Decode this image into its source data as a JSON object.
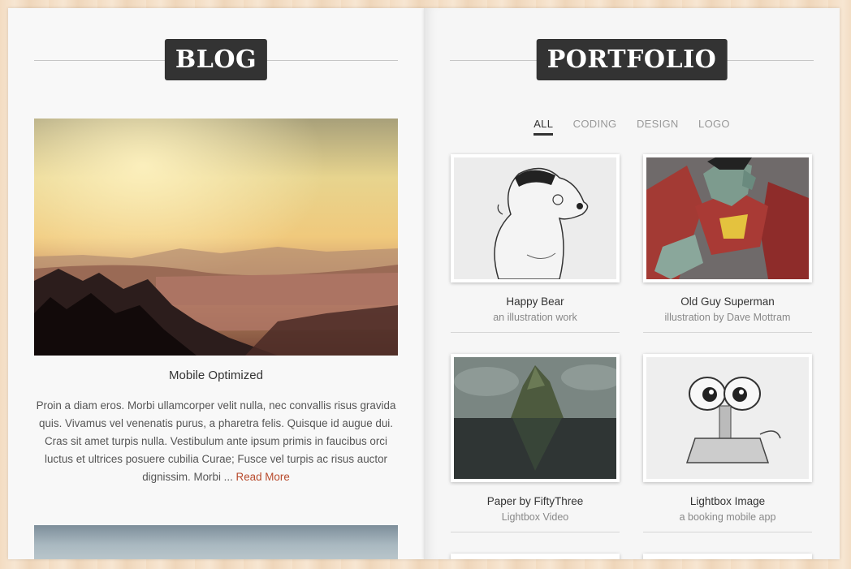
{
  "blog": {
    "heading": "BLOG",
    "post": {
      "title": "Mobile Optimized",
      "excerpt": "Proin a diam eros. Morbi ullamcorper velit nulla, nec convallis risus gravida quis. Vivamus vel venenatis purus, a pharetra felis. Quisque id augue dui. Cras sit amet turpis nulla. Vestibulum ante ipsum primis in faucibus orci luctus et ultrices posuere cubilia Curae; Fusce vel turpis ac risus auctor dignissim. Morbi ... ",
      "read_more": "Read More"
    }
  },
  "portfolio": {
    "heading": "PORTFOLIO",
    "filters": [
      "ALL",
      "CODING",
      "DESIGN",
      "LOGO"
    ],
    "active_filter": "ALL",
    "items": [
      {
        "title": "Happy Bear",
        "subtitle": "an illustration work"
      },
      {
        "title": "Old Guy Superman",
        "subtitle": "illustration by Dave Mottram"
      },
      {
        "title": "Paper by FiftyThree",
        "subtitle": "Lightbox Video"
      },
      {
        "title": "Lightbox Image",
        "subtitle": "a booking mobile app"
      }
    ]
  },
  "colors": {
    "badge_bg": "#333333",
    "link": "#b84a2c",
    "background_wood": "#f3dcc2"
  }
}
